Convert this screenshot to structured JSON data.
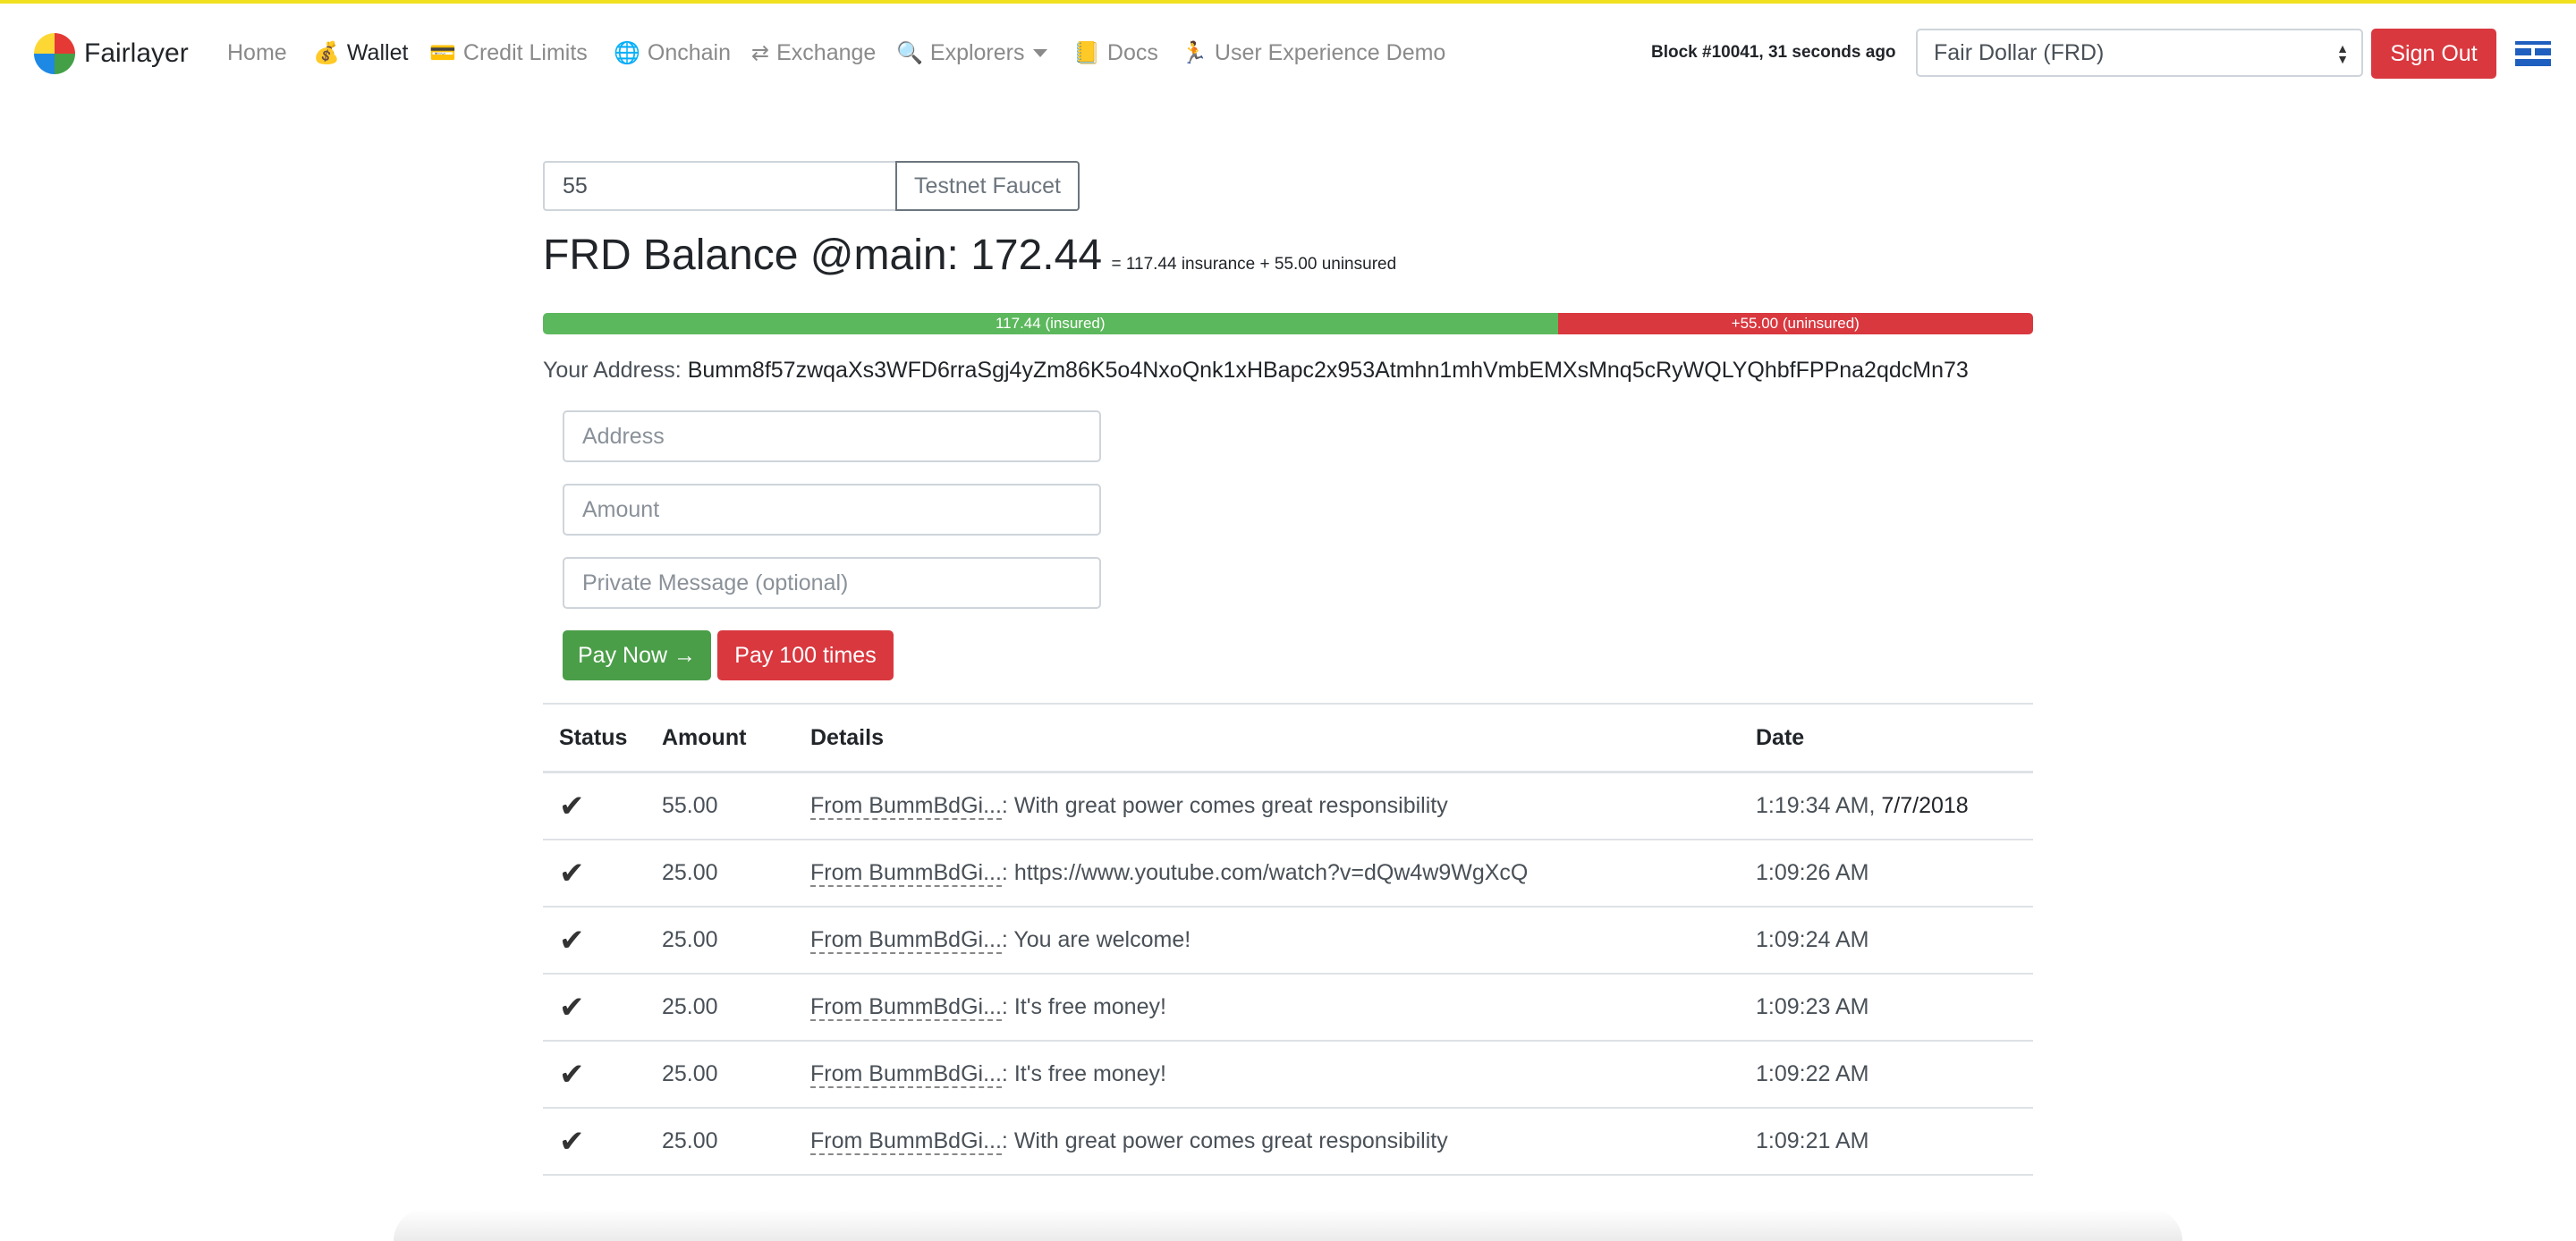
{
  "header": {
    "brand": "Fairlayer",
    "nav": [
      {
        "icon": "💰",
        "icon_name": "money-bag-icon",
        "label": "Wallet",
        "active": true
      },
      {
        "icon": "💳",
        "icon_name": "credit-card-icon",
        "label": "Credit Limits"
      },
      {
        "icon": "🌐",
        "icon_name": "globe-icon",
        "label": "Onchain"
      },
      {
        "icon": "⇄",
        "icon_name": "exchange-arrows-icon",
        "label": "Exchange"
      },
      {
        "icon": "🔍",
        "icon_name": "magnifier-icon",
        "label": "Explorers"
      },
      {
        "icon": "📒",
        "icon_name": "ledger-icon",
        "label": "Docs"
      },
      {
        "icon": "🏃",
        "icon_name": "runner-icon",
        "label": "User Experience Demo"
      }
    ],
    "home_label": "Home",
    "block_info": "Block #10041, 31 seconds ago",
    "asset_selected": "Fair Dollar (FRD)",
    "sign_out": "Sign Out"
  },
  "faucet": {
    "amount_value": "55",
    "button_label": "Testnet Faucet"
  },
  "balance": {
    "title": "FRD Balance @main: 172.44",
    "breakdown": "= 117.44 insurance + 55.00 uninsured",
    "insured_label": "117.44 (insured)",
    "uninsured_label": "+55.00 (uninsured)",
    "insured_fraction": 0.681,
    "uninsured_fraction": 0.319
  },
  "address": {
    "label": "Your Address:",
    "value": "Bumm8f57zwqaXs3WFD6rraSgj4yZm86K5o4NxoQnk1xHBapc2x953Atmhn1mhVmbEMXsMnq5cRyWQLYQhbfFPPna2qdcMn73"
  },
  "pay_form": {
    "address_placeholder": "Address",
    "amount_placeholder": "Amount",
    "message_placeholder": "Private Message (optional)",
    "pay_now": "Pay Now →",
    "pay_100": "Pay 100 times"
  },
  "colors": {
    "insured": "#5cb85c",
    "uninsured": "#d9383f",
    "pay_now": "#4a9e48",
    "danger": "#d9383f"
  },
  "table": {
    "headers": [
      "Status",
      "Amount",
      "Details",
      "Date"
    ],
    "rows": [
      {
        "status": "✔",
        "amount": "55.00",
        "from": "From BummBdGi...",
        "message": ": With great power comes great responsibility",
        "time": "1:19:34 AM,",
        "day": "7/7/2018"
      },
      {
        "status": "✔",
        "amount": "25.00",
        "from": "From BummBdGi...",
        "message": ": https://www.youtube.com/watch?v=dQw4w9WgXcQ",
        "time": "1:09:26 AM",
        "day": ""
      },
      {
        "status": "✔",
        "amount": "25.00",
        "from": "From BummBdGi...",
        "message": ": You are welcome!",
        "time": "1:09:24 AM",
        "day": ""
      },
      {
        "status": "✔",
        "amount": "25.00",
        "from": "From BummBdGi...",
        "message": ": It's free money!",
        "time": "1:09:23 AM",
        "day": ""
      },
      {
        "status": "✔",
        "amount": "25.00",
        "from": "From BummBdGi...",
        "message": ": It's free money!",
        "time": "1:09:22 AM",
        "day": ""
      },
      {
        "status": "✔",
        "amount": "25.00",
        "from": "From BummBdGi...",
        "message": ": With great power comes great responsibility",
        "time": "1:09:21 AM",
        "day": ""
      }
    ]
  }
}
